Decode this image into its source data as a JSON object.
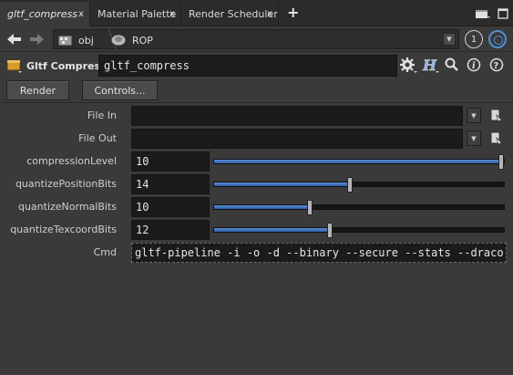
{
  "tabs": [
    {
      "label": "gltf_compress",
      "active": true
    },
    {
      "label": "Material Palette",
      "active": false
    },
    {
      "label": "Render Scheduler",
      "active": false
    }
  ],
  "tab_close_glyph": "x",
  "new_tab_glyph": "+",
  "path": {
    "crumbs": [
      {
        "label": "obj",
        "icon": "obj-network-icon"
      },
      {
        "label": "ROP",
        "icon": "rop-network-icon"
      }
    ],
    "pin_number": "1"
  },
  "node": {
    "type_label": "Gltf Compress",
    "name": "gltf_compress"
  },
  "buttons": {
    "render": "Render",
    "controls": "Controls..."
  },
  "parms": {
    "file_in": {
      "label": "File In",
      "value": ""
    },
    "file_out": {
      "label": "File Out",
      "value": ""
    },
    "compression_level": {
      "label": "compressionLevel",
      "value": "10",
      "fraction": 1.0
    },
    "quantize_position": {
      "label": "quantizePositionBits",
      "value": "14",
      "fraction": 0.47
    },
    "quantize_normal": {
      "label": "quantizeNormalBits",
      "value": "10",
      "fraction": 0.33
    },
    "quantize_texcoord": {
      "label": "quantizeTexcoordBits",
      "value": "12",
      "fraction": 0.4
    },
    "cmd": {
      "label": "Cmd",
      "value": "gltf-pipeline -i  -o  -d --binary --secure --stats --draco.compressionLevel"
    }
  },
  "colors": {
    "background": "#3a3a3a",
    "field": "#1b1b1b",
    "slider_fill": "#4a7cc4",
    "accent_blue": "#4f8fd0"
  }
}
